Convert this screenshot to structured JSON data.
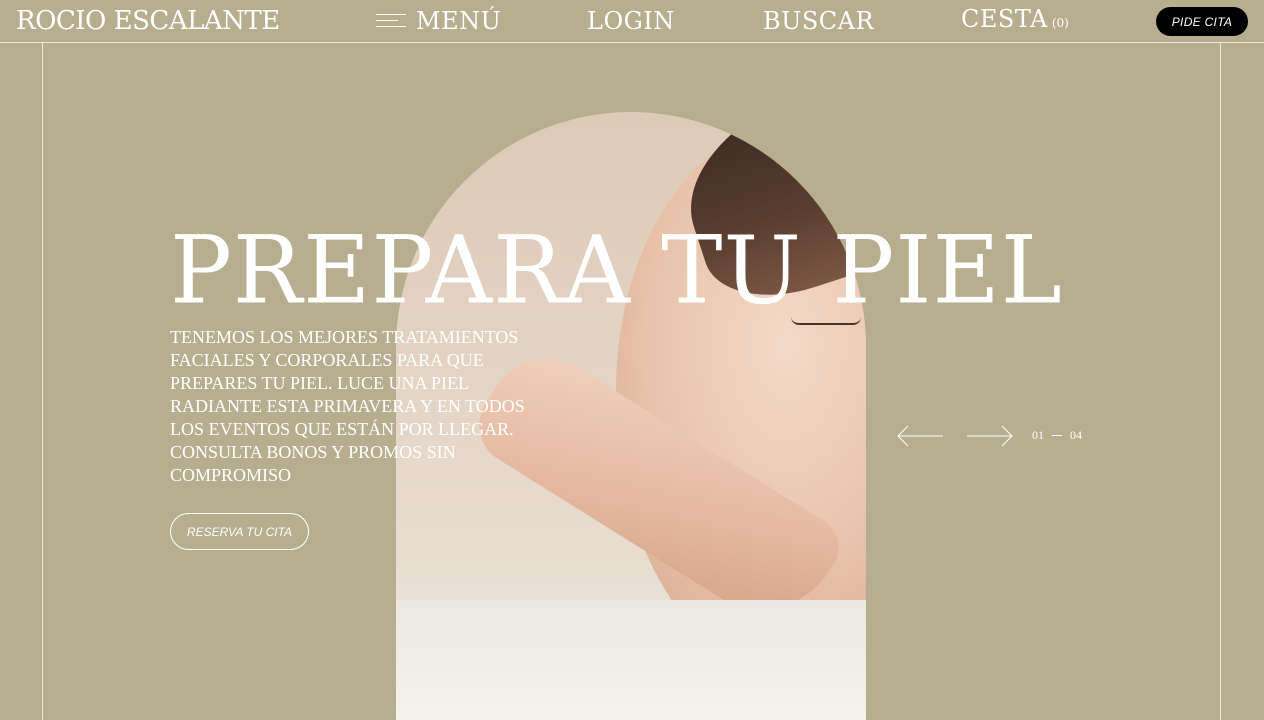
{
  "header": {
    "brand": "ROCIO ESCALANTE",
    "menu_label": "MENÚ",
    "login_label": "LOGIN",
    "search_label": "BUSCAR",
    "cart_label": "CESTA",
    "cart_count": "(0)",
    "cta_label": "PIDE CITA"
  },
  "hero": {
    "title": "PREPARA TU PIEL",
    "description": "TENEMOS LOS MEJORES TRATAMIENTOS FACIALES Y CORPORALES PARA QUE PREPARES TU PIEL. LUCE UNA PIEL RADIANTE ESTA PRIMAVERA Y EN TODOS LOS EVENTOS QUE ESTÁN POR LLEGAR. CONSULTA BONOS Y PROMOS SIN COMPROMISO",
    "button_label": "RESERVA TU CITA"
  },
  "slider": {
    "current": "01",
    "total": "04",
    "prev_icon": "arrow-left-icon",
    "next_icon": "arrow-right-icon"
  },
  "colors": {
    "background": "#b6ae8f",
    "text": "#ffffff",
    "cta": "#000000"
  }
}
